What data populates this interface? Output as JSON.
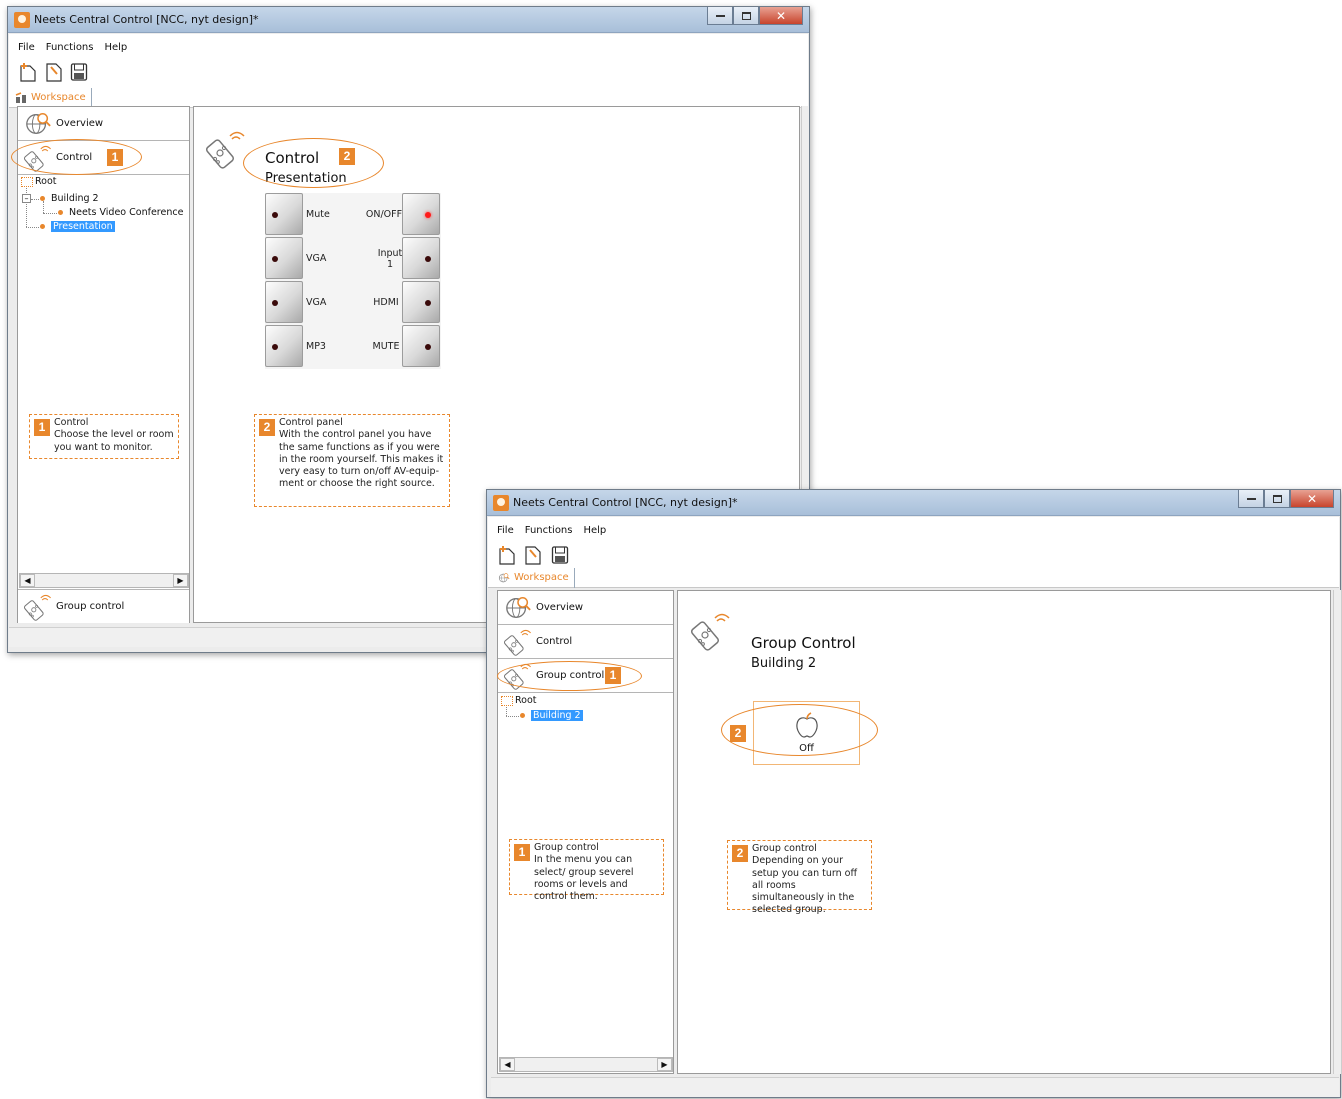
{
  "window1": {
    "title": "Neets Central Control [NCC, nyt design]*",
    "menu": [
      "File",
      "Functions",
      "Help"
    ],
    "workspace_tab": "Workspace",
    "nav": {
      "overview": "Overview",
      "control": "Control",
      "group_control": "Group control"
    },
    "tree": {
      "root": "Root",
      "building": "Building 2",
      "room": "Neets Video Conference",
      "selected": "Presentation"
    },
    "main": {
      "title": "Control",
      "subtitle": "Presentation"
    },
    "badges": {
      "one": "1",
      "two": "2"
    },
    "control_panel": {
      "left_labels": [
        "Mute",
        "VGA",
        "VGA",
        "MP3"
      ],
      "right_labels": [
        "ON/OFF",
        "Input 1",
        "HDMI",
        "MUTE"
      ]
    },
    "callout1": {
      "title": "Control",
      "body": "Choose the level or room you want to monitor."
    },
    "callout2": {
      "title": "Control panel",
      "body": "With the control panel you have the same functions as if you were in the room yourself. This makes it very easy to turn on/off AV-equip-ment or choose the right source."
    }
  },
  "window2": {
    "title": "Neets Central Control [NCC, nyt design]*",
    "menu": [
      "File",
      "Functions",
      "Help"
    ],
    "workspace_tab": "Workspace",
    "nav": {
      "overview": "Overview",
      "control": "Control",
      "group_control": "Group control"
    },
    "tree": {
      "root": "Root",
      "selected": "Building 2"
    },
    "main": {
      "title": "Group Control",
      "subtitle": "Building 2",
      "off_label": "Off"
    },
    "callout1": {
      "title": "Group control",
      "body": "In the menu you can select/ group severel rooms or levels and control them."
    },
    "callout2": {
      "title": "Group control",
      "body": "Depending on your setup you can turn off all rooms simultaneously in the selected group."
    }
  },
  "colors": {
    "accent": "#e8872c",
    "selection": "#3399ff",
    "led_on": "#ff1a1a"
  }
}
